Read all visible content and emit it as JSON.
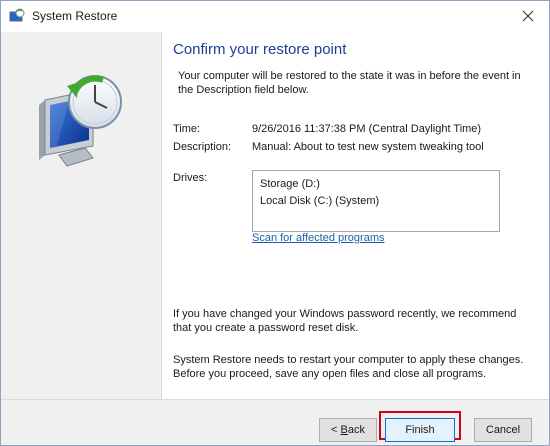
{
  "window": {
    "title": "System Restore"
  },
  "heading": "Confirm your restore point",
  "intro": "Your computer will be restored to the state it was in before the event in the Description field below.",
  "details": {
    "time_label": "Time:",
    "time_value": "9/26/2016 11:37:38 PM (Central Daylight Time)",
    "description_label": "Description:",
    "description_value": "Manual: About to test new system tweaking tool",
    "drives_label": "Drives:",
    "drives": [
      "Storage (D:)",
      "Local Disk (C:) (System)"
    ]
  },
  "scan_link": "Scan for affected programs",
  "password_note": "If you have changed your Windows password recently, we recommend that you create a password reset disk.",
  "restart_note": "System Restore needs to restart your computer to apply these changes. Before you proceed, save any open files and close all programs.",
  "buttons": {
    "back_prefix": "< ",
    "back_mnemonic": "B",
    "back_rest": "ack",
    "finish": "Finish",
    "cancel": "Cancel"
  },
  "icons": {
    "title": "system-restore-icon",
    "hero": "system-restore-clock-monitor-icon",
    "close": "close-icon"
  },
  "colors": {
    "heading": "#1c3f94",
    "link": "#1c5fa8",
    "highlight": "#d0021b",
    "default_button_border": "#0078d7"
  }
}
